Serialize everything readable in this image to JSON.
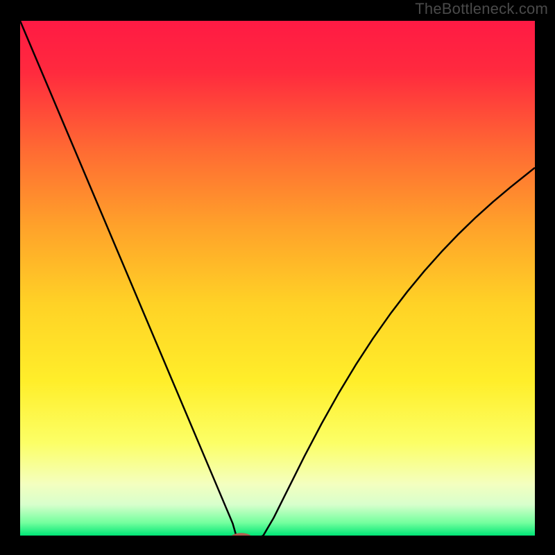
{
  "watermark": "TheBottleneck.com",
  "layout": {
    "outer_w": 800,
    "outer_h": 800,
    "inner_left": 29,
    "inner_top": 30,
    "inner_w": 742,
    "inner_h": 742
  },
  "chart_data": {
    "type": "line",
    "title": "",
    "xlabel": "",
    "ylabel": "",
    "xlim": [
      0,
      100
    ],
    "ylim": [
      0,
      100
    ],
    "grid": false,
    "legend": false,
    "background_gradient_stops": [
      {
        "pct": 0.0,
        "color": "#ff1a44"
      },
      {
        "pct": 0.1,
        "color": "#ff2a3e"
      },
      {
        "pct": 0.25,
        "color": "#ff6a33"
      },
      {
        "pct": 0.4,
        "color": "#ffa22a"
      },
      {
        "pct": 0.55,
        "color": "#ffd226"
      },
      {
        "pct": 0.7,
        "color": "#ffee2a"
      },
      {
        "pct": 0.82,
        "color": "#fcff66"
      },
      {
        "pct": 0.9,
        "color": "#f4ffbf"
      },
      {
        "pct": 0.94,
        "color": "#d7ffcc"
      },
      {
        "pct": 0.975,
        "color": "#74ff9e"
      },
      {
        "pct": 1.0,
        "color": "#00e676"
      }
    ],
    "series": [
      {
        "name": "curve",
        "color": "#000000",
        "stroke_width": 2.5,
        "x": [
          0.0,
          2.66,
          5.33,
          7.99,
          10.66,
          13.32,
          15.99,
          18.65,
          21.32,
          23.98,
          26.65,
          29.31,
          31.98,
          34.64,
          37.31,
          38.64,
          39.97,
          40.64,
          41.3,
          41.97,
          43.97,
          45.96,
          47.23,
          49.23,
          51.23,
          53.23,
          55.23,
          58.56,
          61.89,
          65.22,
          68.55,
          71.88,
          75.21,
          78.55,
          81.88,
          85.21,
          88.54,
          91.87,
          95.2,
          100.0
        ],
        "y": [
          100.0,
          93.7,
          87.4,
          81.1,
          74.8,
          68.5,
          62.2,
          55.9,
          49.6,
          43.3,
          37.0,
          30.7,
          24.4,
          18.1,
          11.8,
          8.65,
          5.5,
          3.93,
          2.35,
          0.0,
          -0.6,
          -0.6,
          0.0,
          3.4,
          7.4,
          11.4,
          15.4,
          21.73,
          27.67,
          33.19,
          38.3,
          43.02,
          47.38,
          51.42,
          55.15,
          58.62,
          61.84,
          64.83,
          67.63,
          71.47
        ]
      }
    ],
    "marker": {
      "comment": "small reddish-brown oval marker at curve minimum",
      "cx": 42.97,
      "cy": -0.6,
      "rx": 2.2,
      "ry": 1.1,
      "fill": "#b06050"
    }
  }
}
